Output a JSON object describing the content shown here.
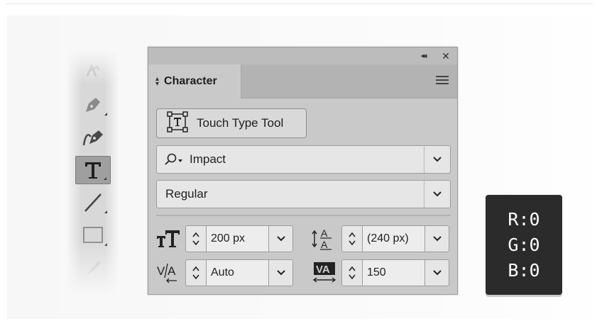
{
  "panel": {
    "tab_label": "Character",
    "touch_type_label": "Touch Type Tool",
    "font_family": "Impact",
    "font_style": "Regular",
    "font_size": "200 px",
    "leading": "(240 px)",
    "kerning": "Auto",
    "tracking": "150"
  },
  "tools": [
    {
      "icon": "anchor-point-icon",
      "selected": false
    },
    {
      "icon": "pen-tool-icon",
      "selected": false
    },
    {
      "icon": "curvature-tool-icon",
      "selected": false
    },
    {
      "icon": "type-tool-icon",
      "selected": true
    },
    {
      "icon": "line-segment-tool-icon",
      "selected": false
    },
    {
      "icon": "rectangle-tool-icon",
      "selected": false
    },
    {
      "icon": "paintbrush-tool-icon",
      "selected": false
    }
  ],
  "rgb": {
    "r": "R:0",
    "g": "G:0",
    "b": "B:0"
  },
  "colors": {
    "panel_bg": "#c9c9c9",
    "readout_bg": "#2b2b2b",
    "selected_tool": "#9f9f9f"
  }
}
